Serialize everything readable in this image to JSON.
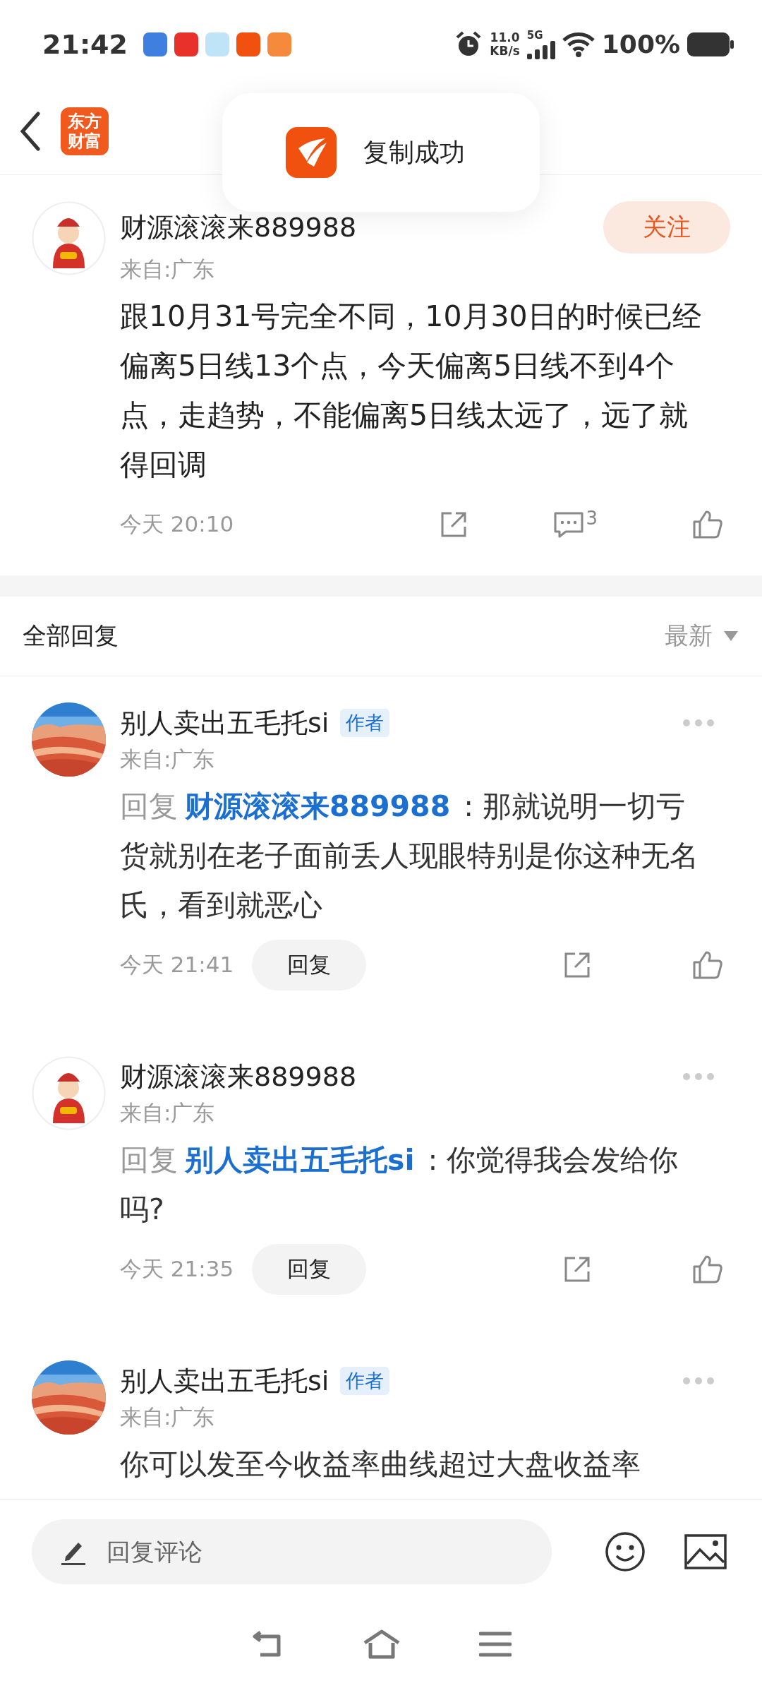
{
  "status_bar": {
    "time": "21:42",
    "net_speed": [
      "11.0",
      "KB/s"
    ],
    "network": "5G",
    "battery": "100%"
  },
  "header": {
    "logo": [
      "东方",
      "财富"
    ]
  },
  "toast": {
    "text": "复制成功"
  },
  "post": {
    "author": "财源滚滚来889988",
    "avatar": {
      "kind": "figure"
    },
    "follow_button": "关注",
    "location": "来自:广东",
    "content": "跟10月31号完全不同，10月30日的时候已经偏离5日线13个点，今天偏离5日线不到4个点，走趋势，不能偏离5日线太远了，远了就得回调",
    "time": "今天 20:10",
    "comment_count": "3"
  },
  "replies_header": {
    "title": "全部回复",
    "sort": "最新"
  },
  "replies": [
    {
      "author": "别人卖出五毛托si",
      "author_tag": "作者",
      "location": "来自:广东",
      "reply_prefix": "回复",
      "reply_to": "财源滚滚来889988",
      "content": " : 那就说明一切亏货就别在老子面前丢人现眼特别是你这种无名氏，看到就恶心",
      "time": "今天 21:41",
      "reply_button": "回复"
    },
    {
      "author": "财源滚滚来889988",
      "avatar": {
        "kind": "figure"
      },
      "location": "来自:广东",
      "reply_prefix": "回复",
      "reply_to": "别人卖出五毛托si",
      "content": " : 你觉得我会发给你吗?",
      "time": "今天 21:35",
      "reply_button": "回复"
    },
    {
      "author": "别人卖出五毛托si",
      "author_tag": "作者",
      "location": "来自:广东",
      "content": "你可以发至今收益率曲线超过大盘收益率"
    }
  ],
  "composer": {
    "placeholder": "回复评论"
  }
}
